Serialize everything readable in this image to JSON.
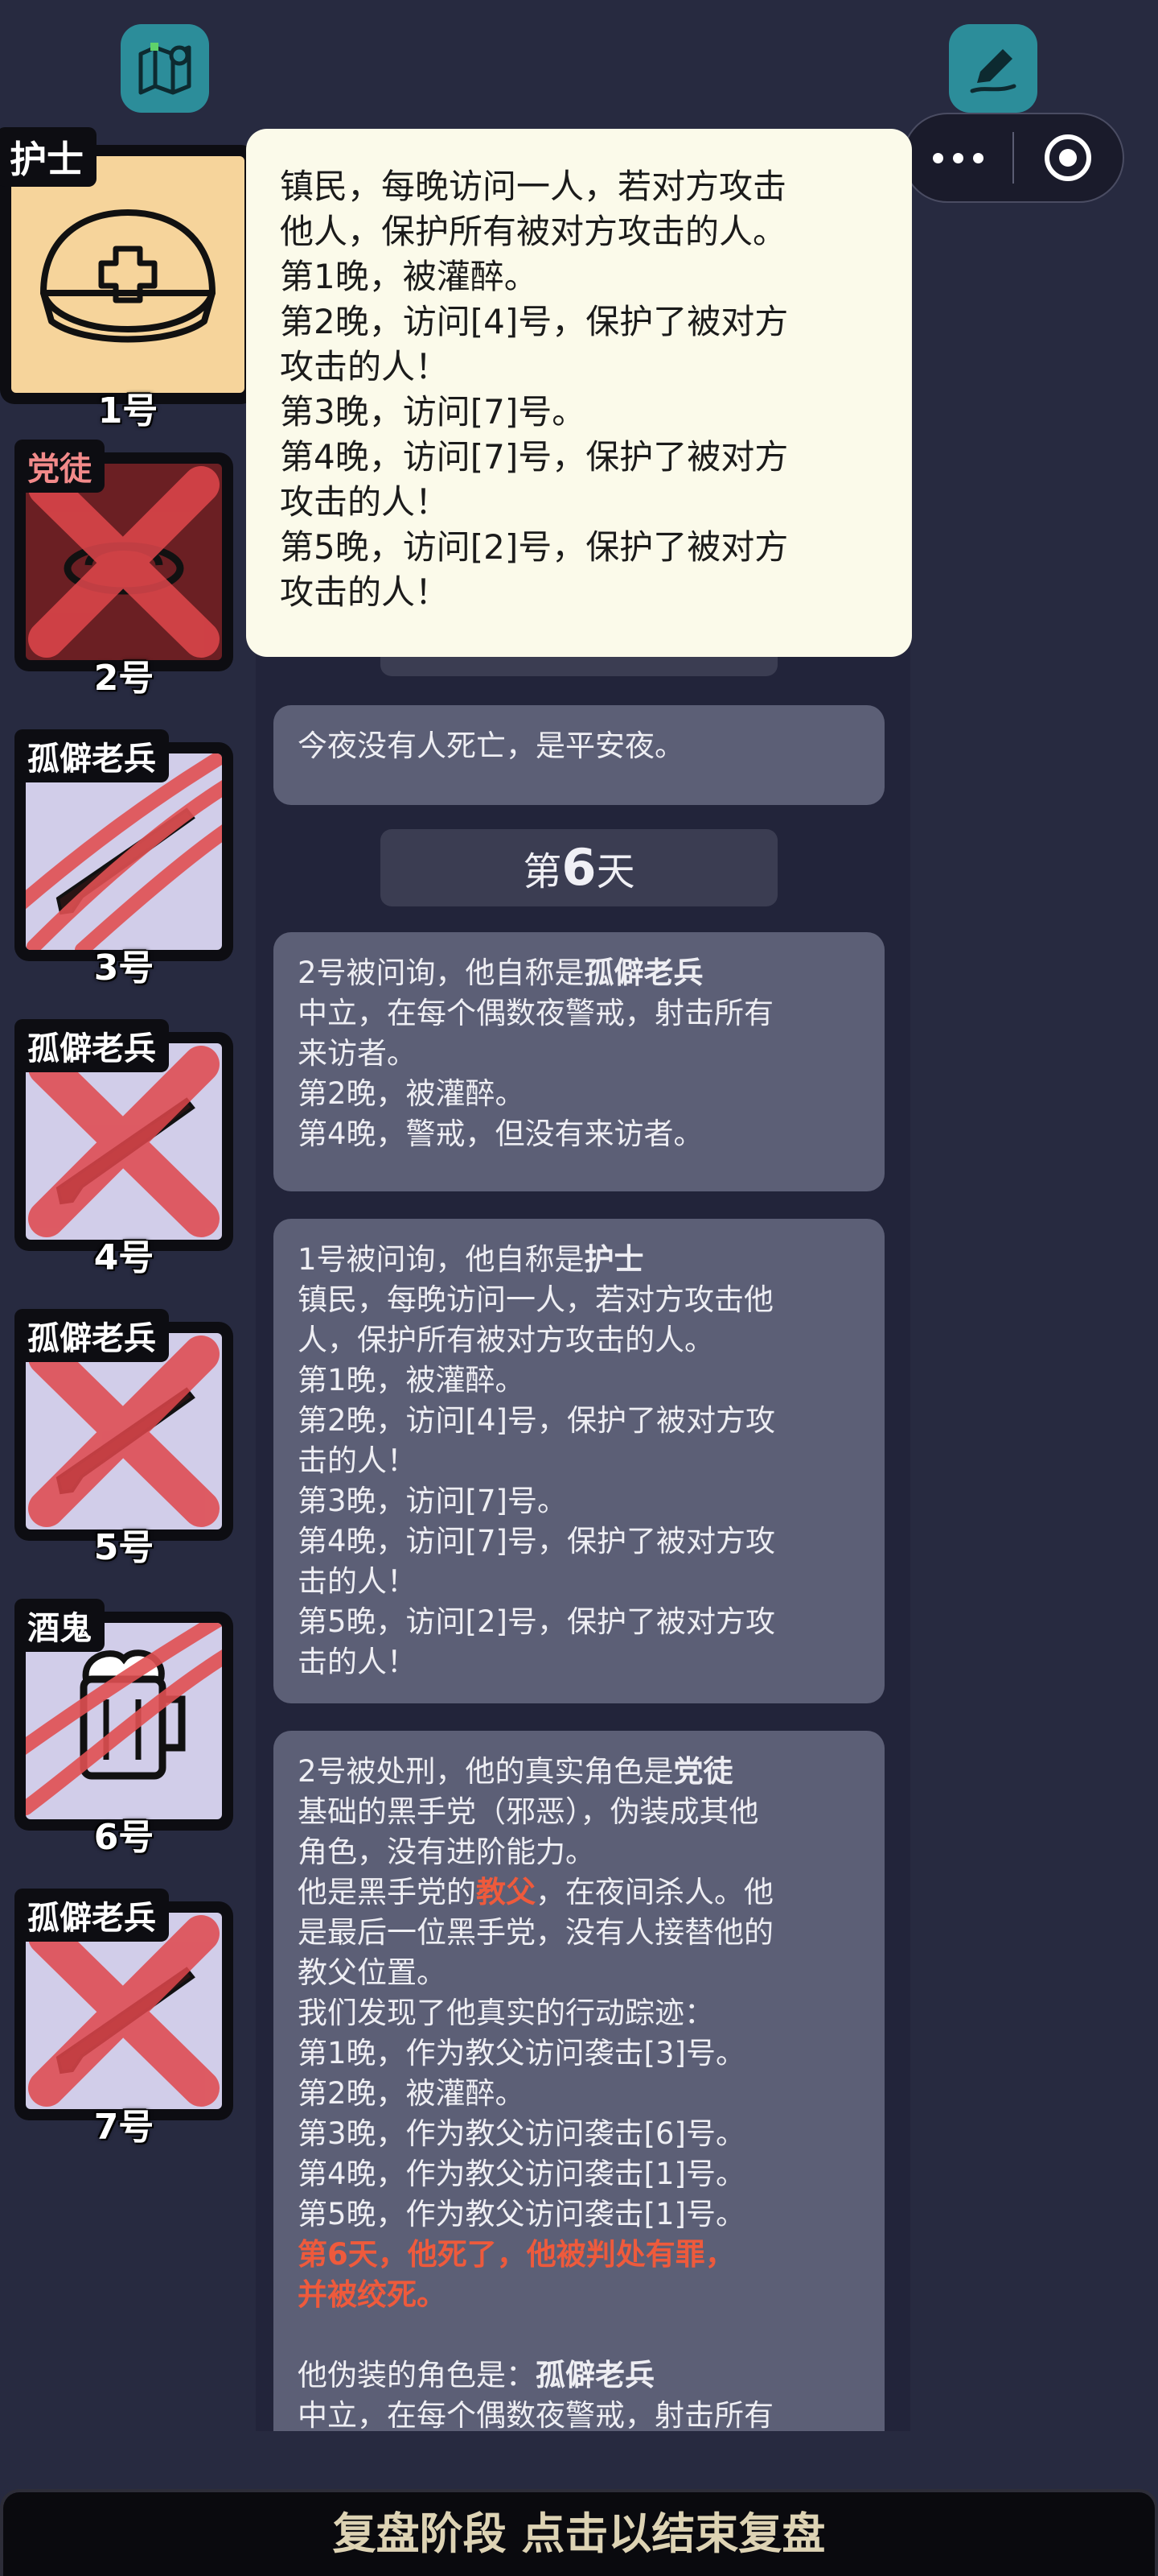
{
  "top_bar": {
    "map_icon": "map-pin-icon",
    "edit_icon": "pen-icon",
    "menu_icon": "more-dots-icon",
    "target_icon": "target-circle-icon"
  },
  "players": [
    {
      "number": "1号",
      "role": "护士",
      "icon": "nurse-cap-icon",
      "state": "alive"
    },
    {
      "number": "2号",
      "role": "党徒",
      "icon": "hat-icon",
      "state": "executed"
    },
    {
      "number": "3号",
      "role": "孤僻老兵",
      "icon": "rifle-icon",
      "state": "attacked"
    },
    {
      "number": "4号",
      "role": "孤僻老兵",
      "icon": "rifle-icon",
      "state": "dead"
    },
    {
      "number": "5号",
      "role": "孤僻老兵",
      "icon": "rifle-icon",
      "state": "dead"
    },
    {
      "number": "6号",
      "role": "酒鬼",
      "icon": "beer-mug-icon",
      "state": "attacked"
    },
    {
      "number": "7号",
      "role": "孤僻老兵",
      "icon": "rifle-icon",
      "state": "dead"
    }
  ],
  "tooltip": {
    "lines": [
      "镇民，每晚访问一人，若对方攻击",
      "他人，保护所有被对方攻击的人。",
      "第1晚，被灌醉。",
      "第2晚，访问[4]号，保护了被对方",
      "攻击的人！",
      "第3晚，访问[7]号。",
      "第4晚，访问[7]号，保护了被对方",
      "攻击的人！",
      "第5晚，访问[2]号，保护了被对方",
      "攻击的人！"
    ]
  },
  "feed": {
    "peace_message": "今夜没有人死亡，是平安夜。",
    "day_prefix": "第",
    "day_number": "6",
    "day_suffix": "天",
    "msg1": {
      "intro": "2号被问询，他自称是",
      "role": "孤僻老兵",
      "lines": [
        "中立，在每个偶数夜警戒，射击所有",
        "来访者。",
        "第2晚，被灌醉。",
        "第4晚，警戒，但没有来访者。"
      ]
    },
    "msg2": {
      "intro": "1号被问询，他自称是",
      "role": "护士",
      "lines": [
        "镇民，每晚访问一人，若对方攻击他",
        "人，保护所有被对方攻击的人。",
        "第1晚，被灌醉。",
        "第2晚，访问[4]号，保护了被对方攻",
        "击的人！",
        "第3晚，访问[7]号。",
        "第4晚，访问[7]号，保护了被对方攻",
        "击的人！",
        "第5晚，访问[2]号，保护了被对方攻",
        "击的人！"
      ]
    },
    "msg3": {
      "intro": "2号被处刑，他的真实角色是",
      "role": "党徒",
      "line1": "基础的黑手党（邪恶），伪装成其他",
      "line2": "角色，没有进阶能力。",
      "godfather_pre": "他是黑手党的",
      "godfather": "教父",
      "godfather_post": "，在夜间杀人。他",
      "line4": "是最后一位黑手党，没有人接替他的",
      "line5": "教父位置。",
      "trace_lines": [
        "我们发现了他真实的行动踪迹：",
        "第1晚，作为教父访问袭击[3]号。",
        "第2晚，被灌醉。",
        "第3晚，作为教父访问袭击[6]号。",
        "第4晚，作为教父访问袭击[1]号。",
        "第5晚，作为教父访问袭击[1]号。"
      ],
      "death_line1": "第6天，他死了，他被判处有罪，",
      "death_line2": "并被绞死。",
      "disguise_pre": "他伪装的角色是：",
      "disguise_role": "孤僻老兵",
      "cut_line": "中立，在每个偶数夜警戒，射击所有"
    }
  },
  "bottom_bar": {
    "label": "复盘阶段 点击以结束复盘"
  }
}
